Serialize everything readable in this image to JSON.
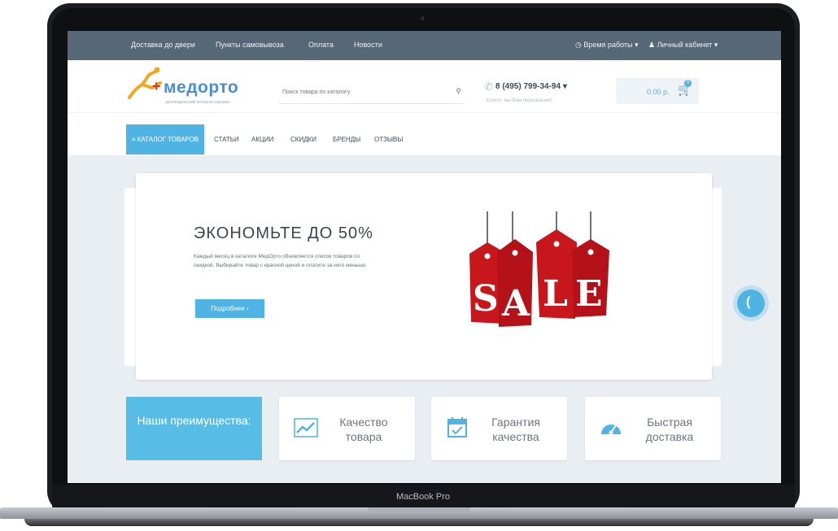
{
  "device": {
    "brand": "MacBook Pro"
  },
  "topbar": {
    "links": [
      "Доставка до двери",
      "Пункты самовывоза",
      "Оплата",
      "Новости"
    ],
    "work_hours": "Время работы",
    "account": "Личный кабинет"
  },
  "header": {
    "logo_text": "медорто",
    "logo_plus": "+",
    "logo_tagline": "ортопедический интернет-магазин",
    "search_placeholder": "Поиск товара по каталогу",
    "phone": "8 (495) 799-34-94",
    "phone_sub": "Хотите, мы Вам перезвоним?",
    "cart_total": "0.00 р.",
    "cart_count": "0"
  },
  "nav": {
    "catalog": "КАТАЛОГ ТОВАРОВ",
    "items": [
      "СТАТЬИ",
      "АКЦИИ",
      "СКИДКИ",
      "БРЕНДЫ",
      "ОТЗЫВЫ"
    ]
  },
  "slide": {
    "title": "ЭКОНОМЬТЕ ДО 50%",
    "text": "Каждый месяц в каталоге МедОрто обновляется список товаров со скидкой. Выбирайте товар с красной ценой и платите за него меньше.",
    "button": "Подробнее",
    "sale_letters": [
      "S",
      "A",
      "L",
      "E"
    ]
  },
  "advantages": {
    "heading": "Наши преимущества:",
    "items": [
      {
        "label": "Качество товара",
        "icon": "chart-up-icon"
      },
      {
        "label": "Гарантия качества",
        "icon": "calendar-check-icon"
      },
      {
        "label": "Быстрая доставка",
        "icon": "speedometer-icon"
      }
    ]
  },
  "colors": {
    "accent": "#4fb3e3",
    "topbar": "#566777",
    "sale": "#c8161d"
  }
}
